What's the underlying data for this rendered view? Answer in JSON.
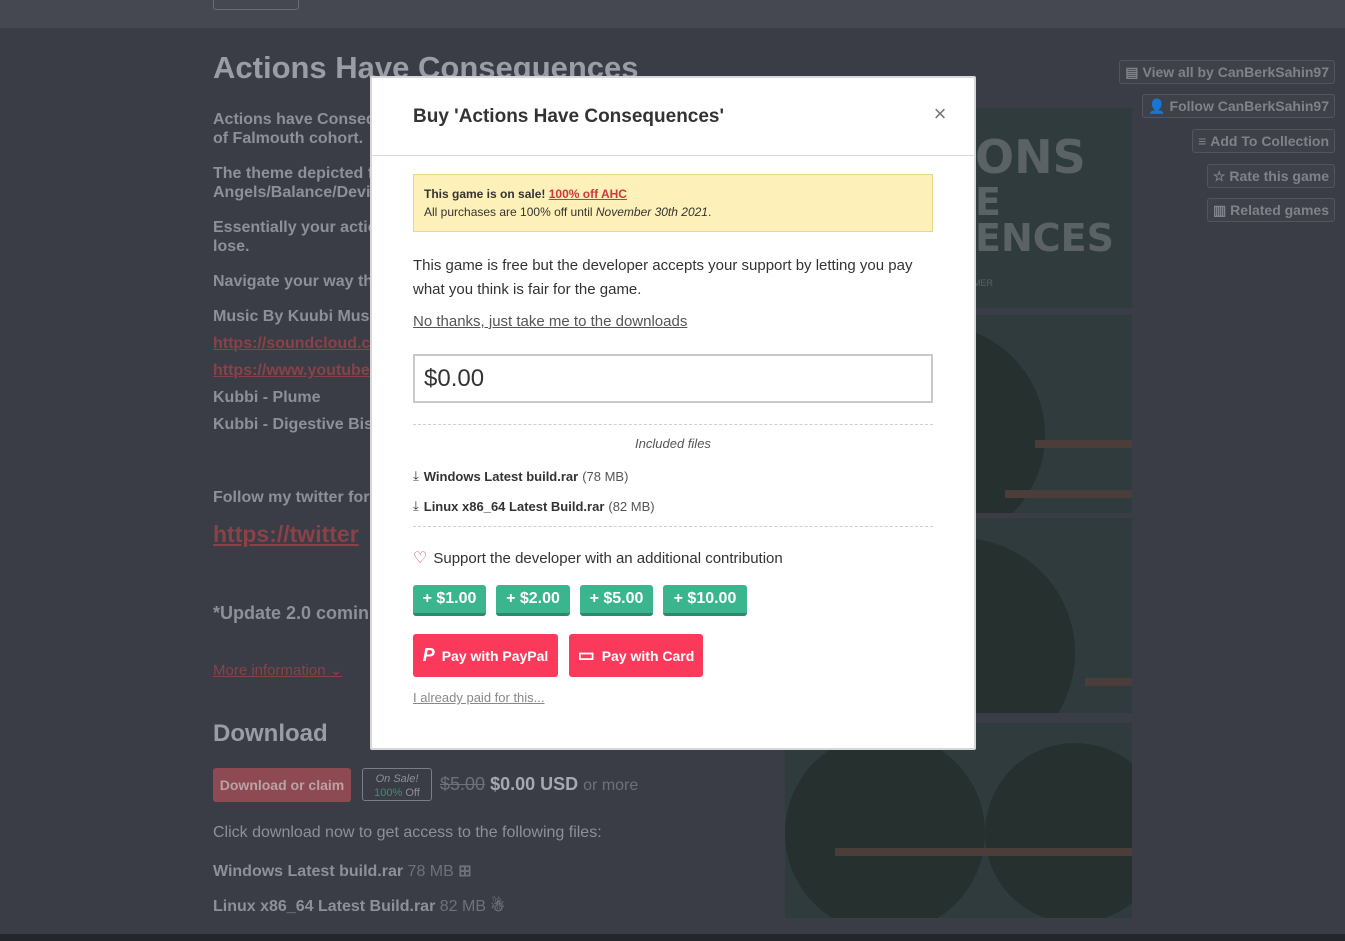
{
  "page": {
    "title": "Actions Have Consequences",
    "description": [
      "Actions have Consequ",
      "of Falmouth cohort.",
      "The theme depicted fr",
      "Angels/Balance/Devil",
      "Essentially your actio",
      "lose.",
      "Navigate your way th",
      "Music By Kuubi Music",
      "https://soundcloud.co",
      "https://www.youtube",
      "Kubbi - Plume",
      "Kubbi - Digestive Bisc",
      "Follow my twitter for",
      "https://twitter",
      "*Update 2.0 comin"
    ],
    "more_information": "More information",
    "download_heading": "Download",
    "download_button": "Download or claim",
    "on_sale": "On Sale!",
    "percent_off": "100%",
    "off": "Off",
    "old_price": "$5.00",
    "new_price": "$0.00 USD",
    "or_more": "or more",
    "download_note": "Click download now to get access to the following files:",
    "files": [
      {
        "name": "Windows Latest build.rar",
        "size": "78 MB",
        "icon": "windows-icon"
      },
      {
        "name": "Linux x86_64 Latest Build.rar",
        "size": "82 MB",
        "icon": "linux-icon"
      }
    ]
  },
  "sidebar": {
    "view_all": "View all by CanBerkSahin97",
    "follow": "Follow CanBerkSahin97",
    "add_collection": "Add To Collection",
    "rate": "Rate this game",
    "related": "Related games"
  },
  "screenshot_text": [
    "ONS",
    "E",
    "ENCES",
    "MER"
  ],
  "modal": {
    "title": "Buy 'Actions Have Consequences'",
    "close": "×",
    "sale_prefix": "This game is on sale!",
    "sale_link": "100% off AHC",
    "sale_detail_prefix": "All purchases are 100% off until",
    "sale_date": "November 30th 2021",
    "sale_detail_suffix": ".",
    "free_text": "This game is free but the developer accepts your support by letting you pay what you think is fair for the game.",
    "no_thanks": "No thanks, just take me to the downloads",
    "price_value": "$0.00",
    "included_files": "Included files",
    "files": [
      {
        "name": "Windows Latest build.rar",
        "size": "(78 MB)"
      },
      {
        "name": "Linux x86_64 Latest Build.rar",
        "size": "(82 MB)"
      }
    ],
    "support_text": "Support the developer with an additional contribution",
    "add_buttons": [
      "+ $1.00",
      "+ $2.00",
      "+ $5.00",
      "+ $10.00"
    ],
    "pay_paypal": "Pay with PayPal",
    "pay_card": "Pay with Card",
    "already_paid": "I already paid for this..."
  },
  "colors": {
    "accent_red": "#fa395b",
    "accent_green": "#3bb58d",
    "sale_banner": "#fdf0b8",
    "page_bg": "#3a3d45"
  }
}
